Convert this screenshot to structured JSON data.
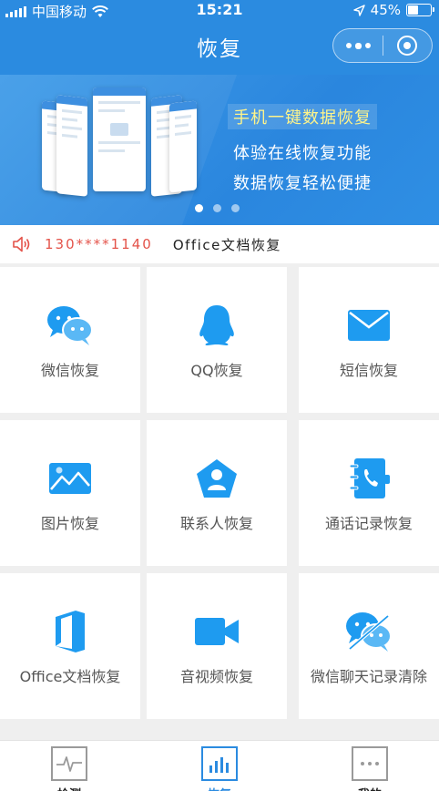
{
  "status_bar": {
    "carrier": "中国移动",
    "time": "15:21",
    "battery": "45%",
    "battery_level": 0.45
  },
  "header": {
    "title": "恢复"
  },
  "banner": {
    "lines": [
      "手机一键数据恢复",
      "体验在线恢复功能",
      "数据恢复轻松便捷"
    ],
    "slide_count": 3,
    "active_slide": 0
  },
  "notice": {
    "phone": "130****1140",
    "message": "Office文档恢复"
  },
  "features": [
    {
      "label": "微信恢复",
      "icon": "wechat-icon"
    },
    {
      "label": "QQ恢复",
      "icon": "qq-icon"
    },
    {
      "label": "短信恢复",
      "icon": "envelope-icon"
    },
    {
      "label": "图片恢复",
      "icon": "image-icon"
    },
    {
      "label": "联系人恢复",
      "icon": "contact-icon"
    },
    {
      "label": "通话记录恢复",
      "icon": "call-log-icon"
    },
    {
      "label": "Office文档恢复",
      "icon": "office-icon"
    },
    {
      "label": "音视频恢复",
      "icon": "video-camera-icon"
    },
    {
      "label": "微信聊天记录清除",
      "icon": "wechat-clear-icon"
    }
  ],
  "tabbar": {
    "tabs": [
      {
        "label": "检测",
        "icon": "pulse-icon"
      },
      {
        "label": "恢复",
        "icon": "bar-chart-icon"
      },
      {
        "label": "我的",
        "icon": "ellipsis-icon"
      }
    ],
    "active": 1
  },
  "colors": {
    "primary": "#2b8be0",
    "icon_blue": "#1e9bf0",
    "notice_red": "#e4534a",
    "banner_highlight": "#fff48a"
  }
}
